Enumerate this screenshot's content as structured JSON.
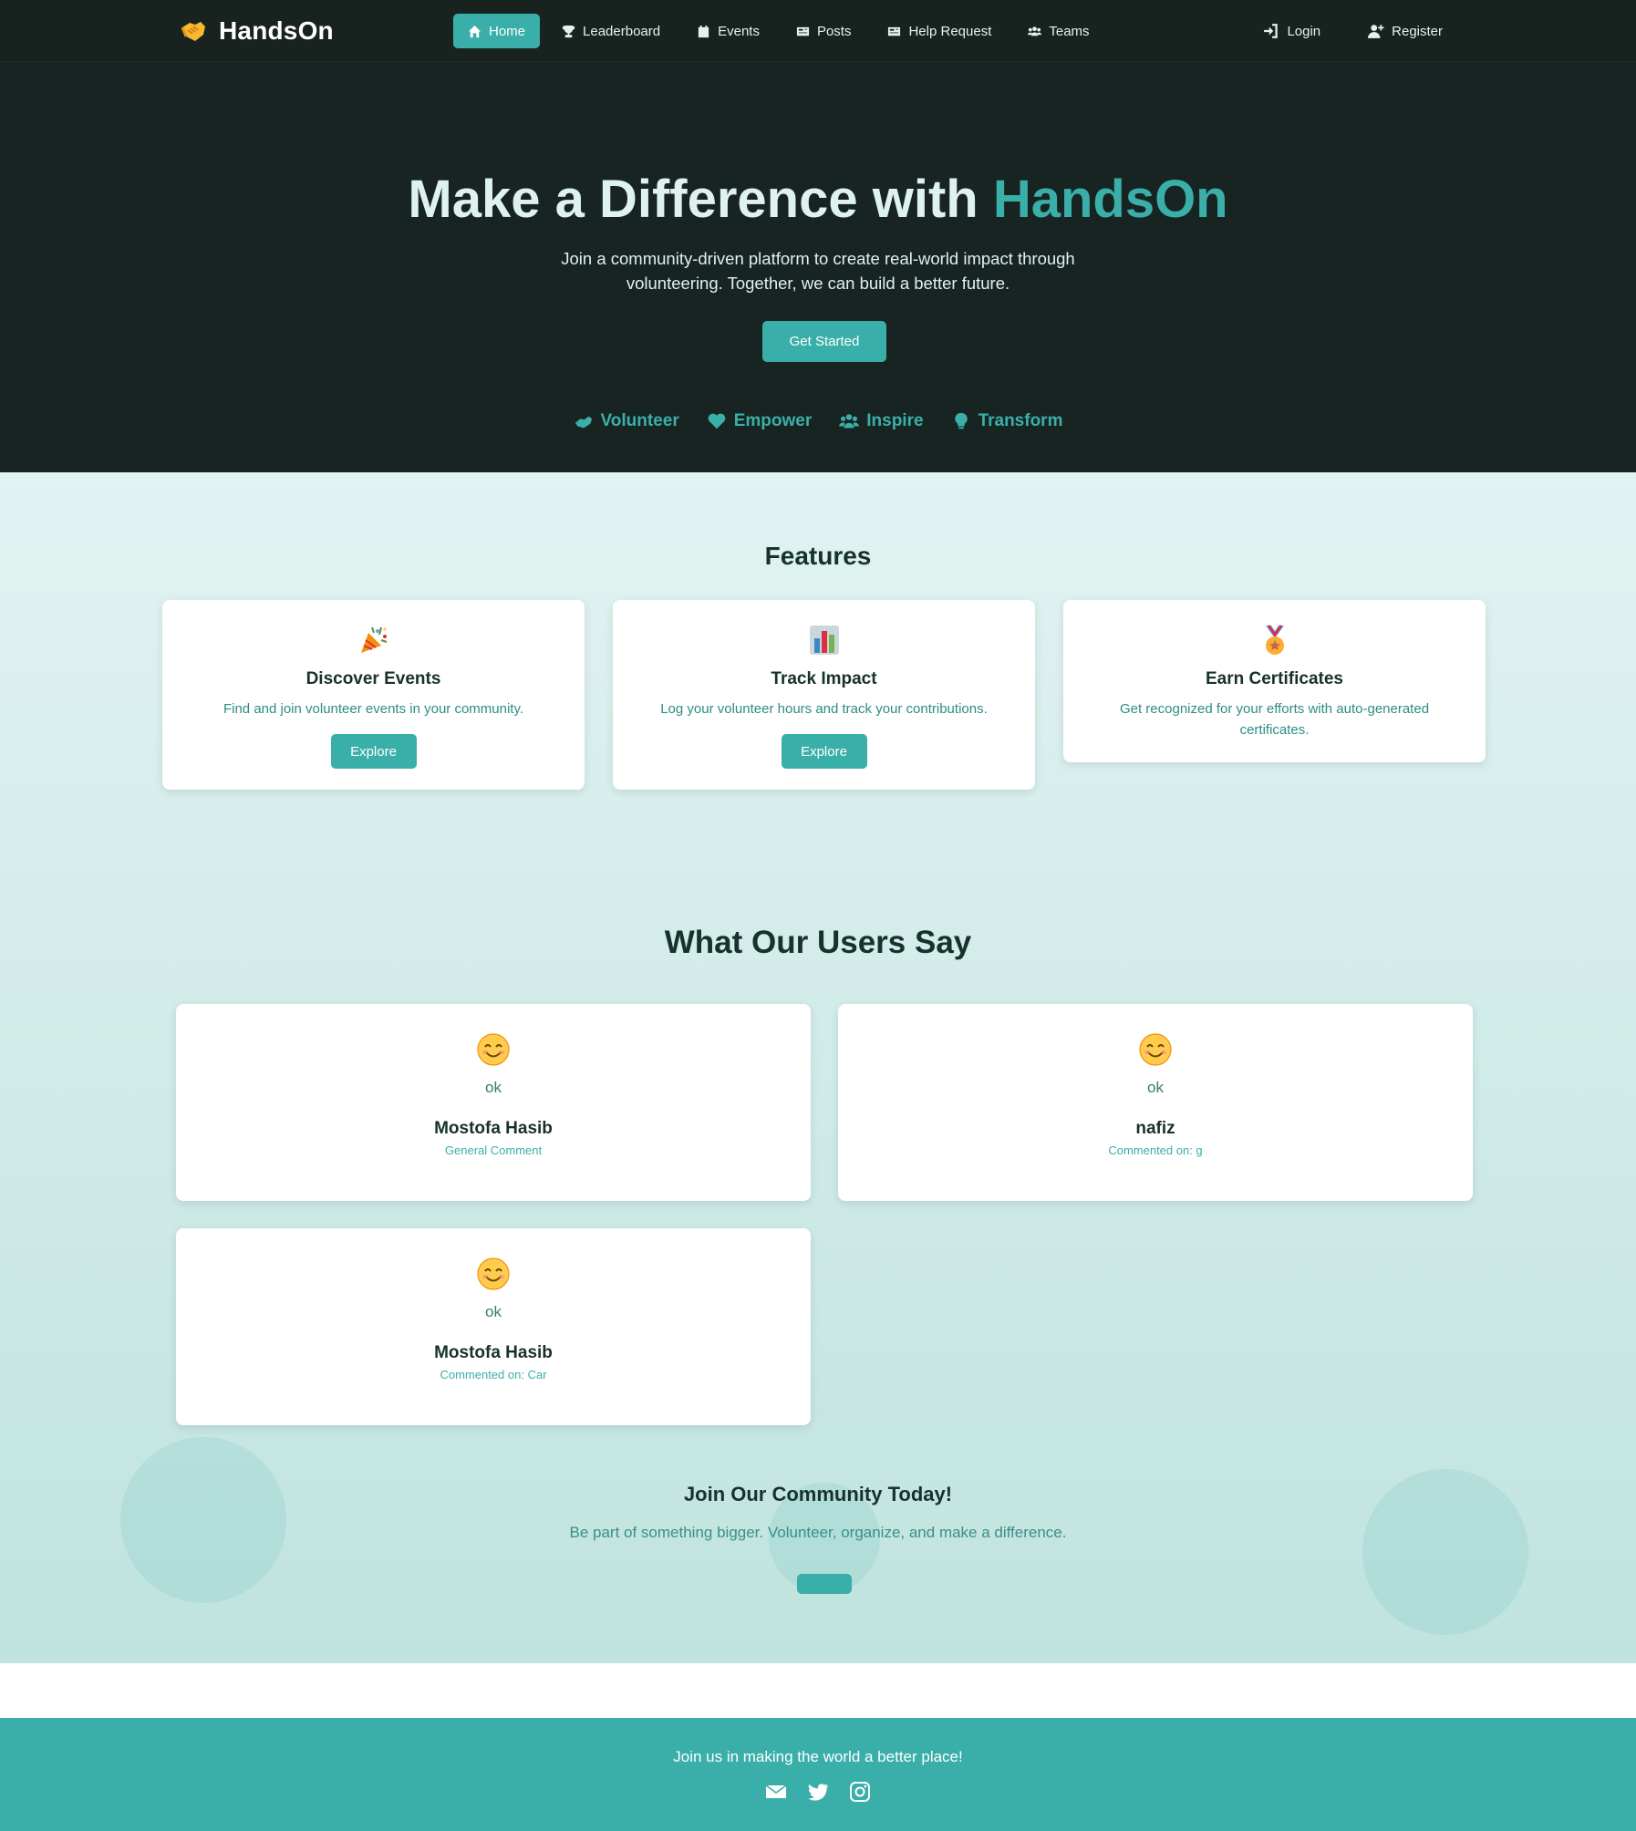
{
  "brand": {
    "name": "HandsOn",
    "icon": "handshake-icon"
  },
  "nav": {
    "items": [
      {
        "label": "Home",
        "icon": "home-icon",
        "active": true
      },
      {
        "label": "Leaderboard",
        "icon": "trophy-icon"
      },
      {
        "label": "Events",
        "icon": "calendar-icon"
      },
      {
        "label": "Posts",
        "icon": "newspaper-icon"
      },
      {
        "label": "Help Request",
        "icon": "newspaper-icon"
      },
      {
        "label": "Teams",
        "icon": "users-icon"
      }
    ],
    "login": "Login",
    "register": "Register"
  },
  "hero": {
    "title_prefix": "Make a Difference with",
    "title_accent": "HandsOn",
    "subtitle": "Join a community-driven platform to create real-world impact through volunteering. Together, we can build a better future.",
    "cta": "Get Started",
    "pillars": [
      "Volunteer",
      "Empower",
      "Inspire",
      "Transform"
    ]
  },
  "features": {
    "title": "Features",
    "cards": [
      {
        "emoji": "party-popper-icon",
        "title": "Discover Events",
        "text": "Find and join volunteer events in your community.",
        "button": "Explore"
      },
      {
        "emoji": "bar-chart-icon",
        "title": "Track Impact",
        "text": "Log your volunteer hours and track your contributions.",
        "button": "Explore"
      },
      {
        "emoji": "medal-icon",
        "title": "Earn Certificates",
        "text": "Get recognized for your efforts with auto-generated certificates."
      }
    ]
  },
  "testimonials": {
    "title": "What Our Users Say",
    "items": [
      {
        "message": "ok",
        "name": "Mostofa Hasib",
        "meta": "General Comment"
      },
      {
        "message": "ok",
        "name": "nafiz",
        "meta": "Commented on: g"
      },
      {
        "message": "ok",
        "name": "Mostofa Hasib",
        "meta": "Commented on: Car"
      }
    ]
  },
  "join": {
    "title": "Join Our Community Today!",
    "subtitle": "Be part of something bigger. Volunteer, organize, and make a difference."
  },
  "footer": {
    "text": "Join us in making the world a better place!",
    "socials": [
      "envelope-icon",
      "twitter-icon",
      "instagram-icon"
    ]
  },
  "colors": {
    "accent": "#3aafa9",
    "dark": "#18231f",
    "heading": "#17322d",
    "light_text": "#def2f1"
  }
}
